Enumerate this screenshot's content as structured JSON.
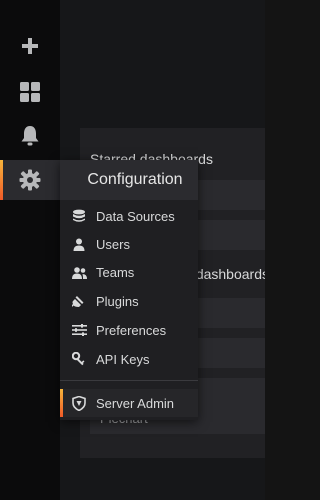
{
  "sidebar": {
    "items": [
      {
        "name": "create",
        "icon": "plus-icon"
      },
      {
        "name": "dashboards",
        "icon": "grid-icon"
      },
      {
        "name": "alerting",
        "icon": "bell-icon"
      },
      {
        "name": "configuration",
        "icon": "gear-icon",
        "active": true
      }
    ]
  },
  "background_panel": {
    "heading": "Starred dashboards",
    "subheading": "Recently viewed dashboards",
    "last_row": "Piechart"
  },
  "dropdown": {
    "header": "Configuration",
    "items": [
      {
        "label": "Data Sources",
        "icon": "database-icon"
      },
      {
        "label": "Users",
        "icon": "user-icon"
      },
      {
        "label": "Teams",
        "icon": "users-icon"
      },
      {
        "label": "Plugins",
        "icon": "plug-icon"
      },
      {
        "label": "Preferences",
        "icon": "sliders-icon"
      },
      {
        "label": "API Keys",
        "icon": "key-icon"
      }
    ],
    "admin": {
      "label": "Server Admin",
      "icon": "shield-icon"
    }
  },
  "colors": {
    "accent_start": "#f7b43c",
    "accent_end": "#f05a28",
    "sidebar_bg": "#0b0b0c",
    "menu_bg": "#1f1f22"
  }
}
